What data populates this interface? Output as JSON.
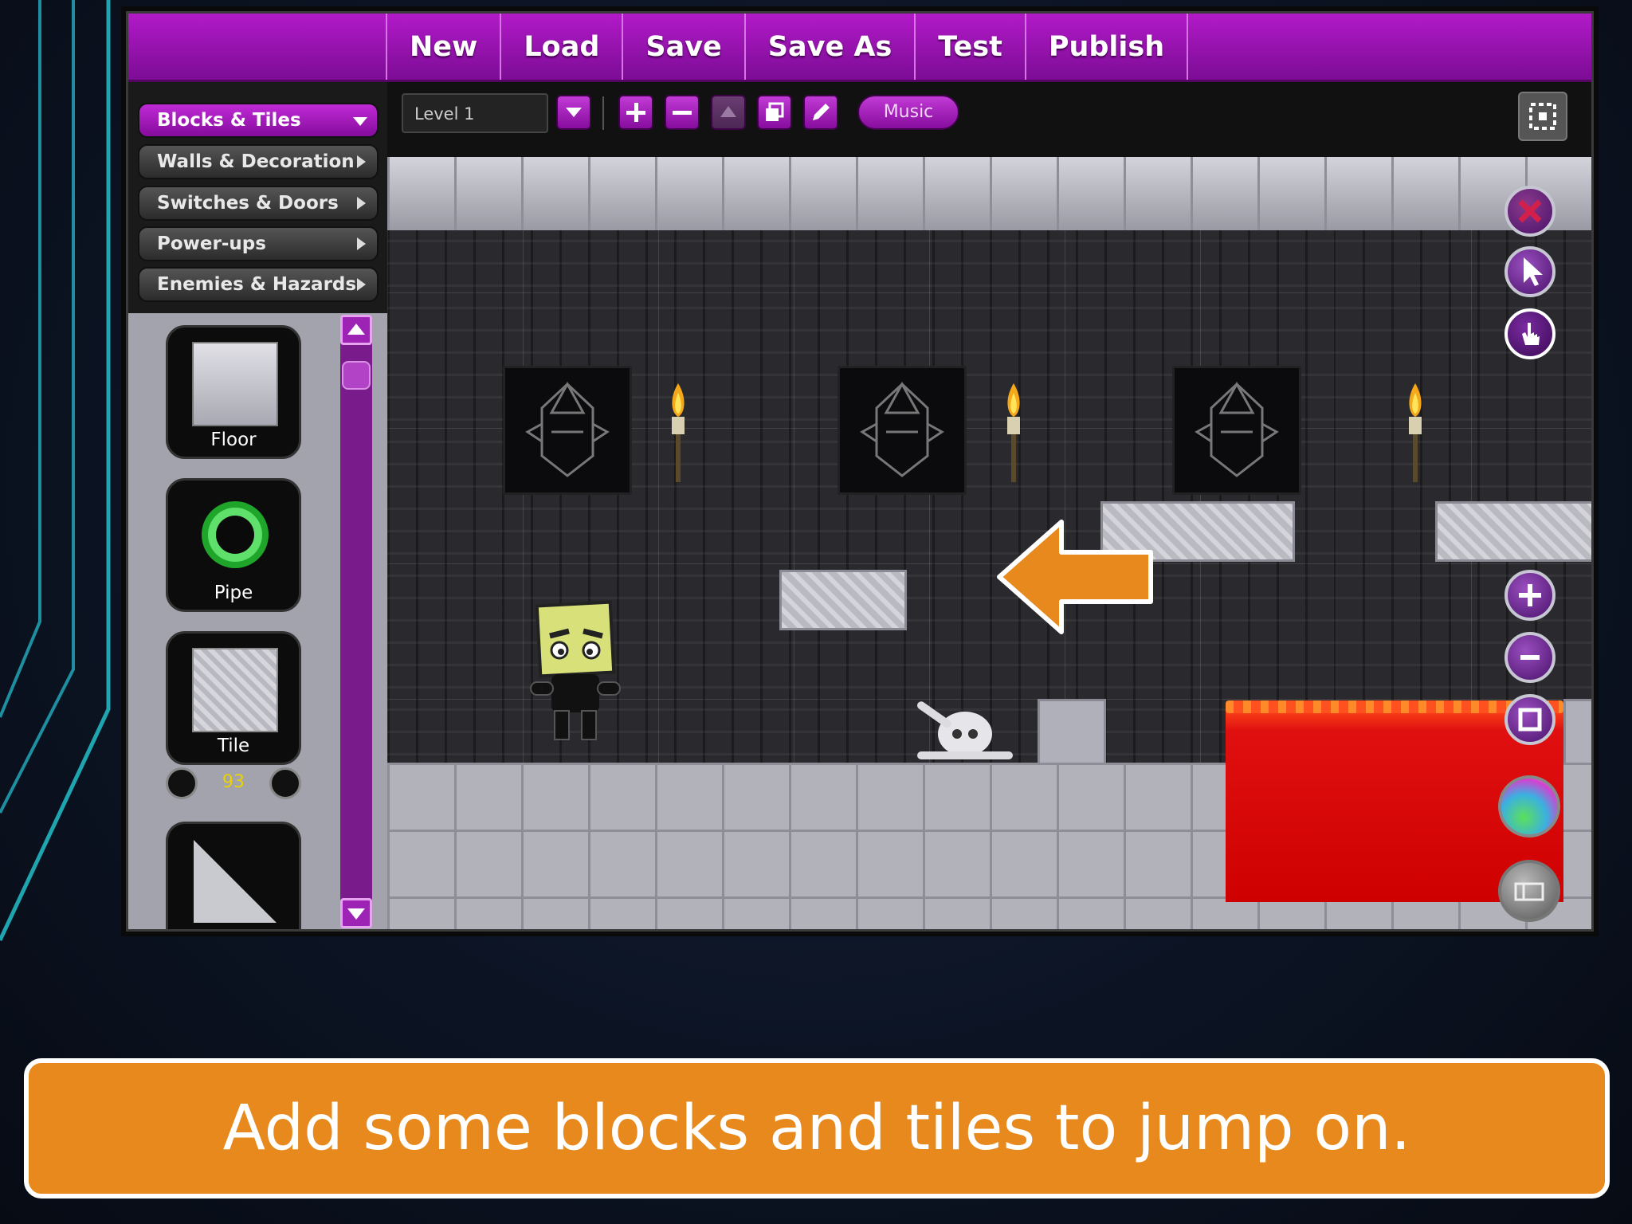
{
  "menu": {
    "items": [
      "New",
      "Load",
      "Save",
      "Save As",
      "Test",
      "Publish"
    ]
  },
  "palette": {
    "categories": [
      {
        "label": "Blocks & Tiles",
        "active": true
      },
      {
        "label": "Walls & Decoration",
        "active": false
      },
      {
        "label": "Switches & Doors",
        "active": false
      },
      {
        "label": "Power-ups",
        "active": false
      },
      {
        "label": "Enemies & Hazards",
        "active": false
      }
    ],
    "tiles": [
      {
        "label": "Floor"
      },
      {
        "label": "Pipe"
      },
      {
        "label": "Tile"
      }
    ],
    "page_number": "93"
  },
  "toolbar": {
    "level_name": "Level 1",
    "music_label": "Music",
    "icons": [
      "dropdown-icon",
      "add-icon",
      "remove-icon",
      "move-up-icon",
      "duplicate-icon",
      "edit-icon",
      "grid-icon"
    ]
  },
  "side_tools": [
    "delete-icon",
    "pointer-icon",
    "hand-icon",
    "zoom-in-icon",
    "zoom-out-icon",
    "fit-icon",
    "color-icon",
    "background-icon"
  ],
  "caption": {
    "text": "Add some blocks and tiles to jump on."
  },
  "colors": {
    "accent_purple": "#a614bd",
    "caption_orange": "#e8891d",
    "lava_red": "#d40000",
    "arrow_orange": "#e8891d"
  }
}
